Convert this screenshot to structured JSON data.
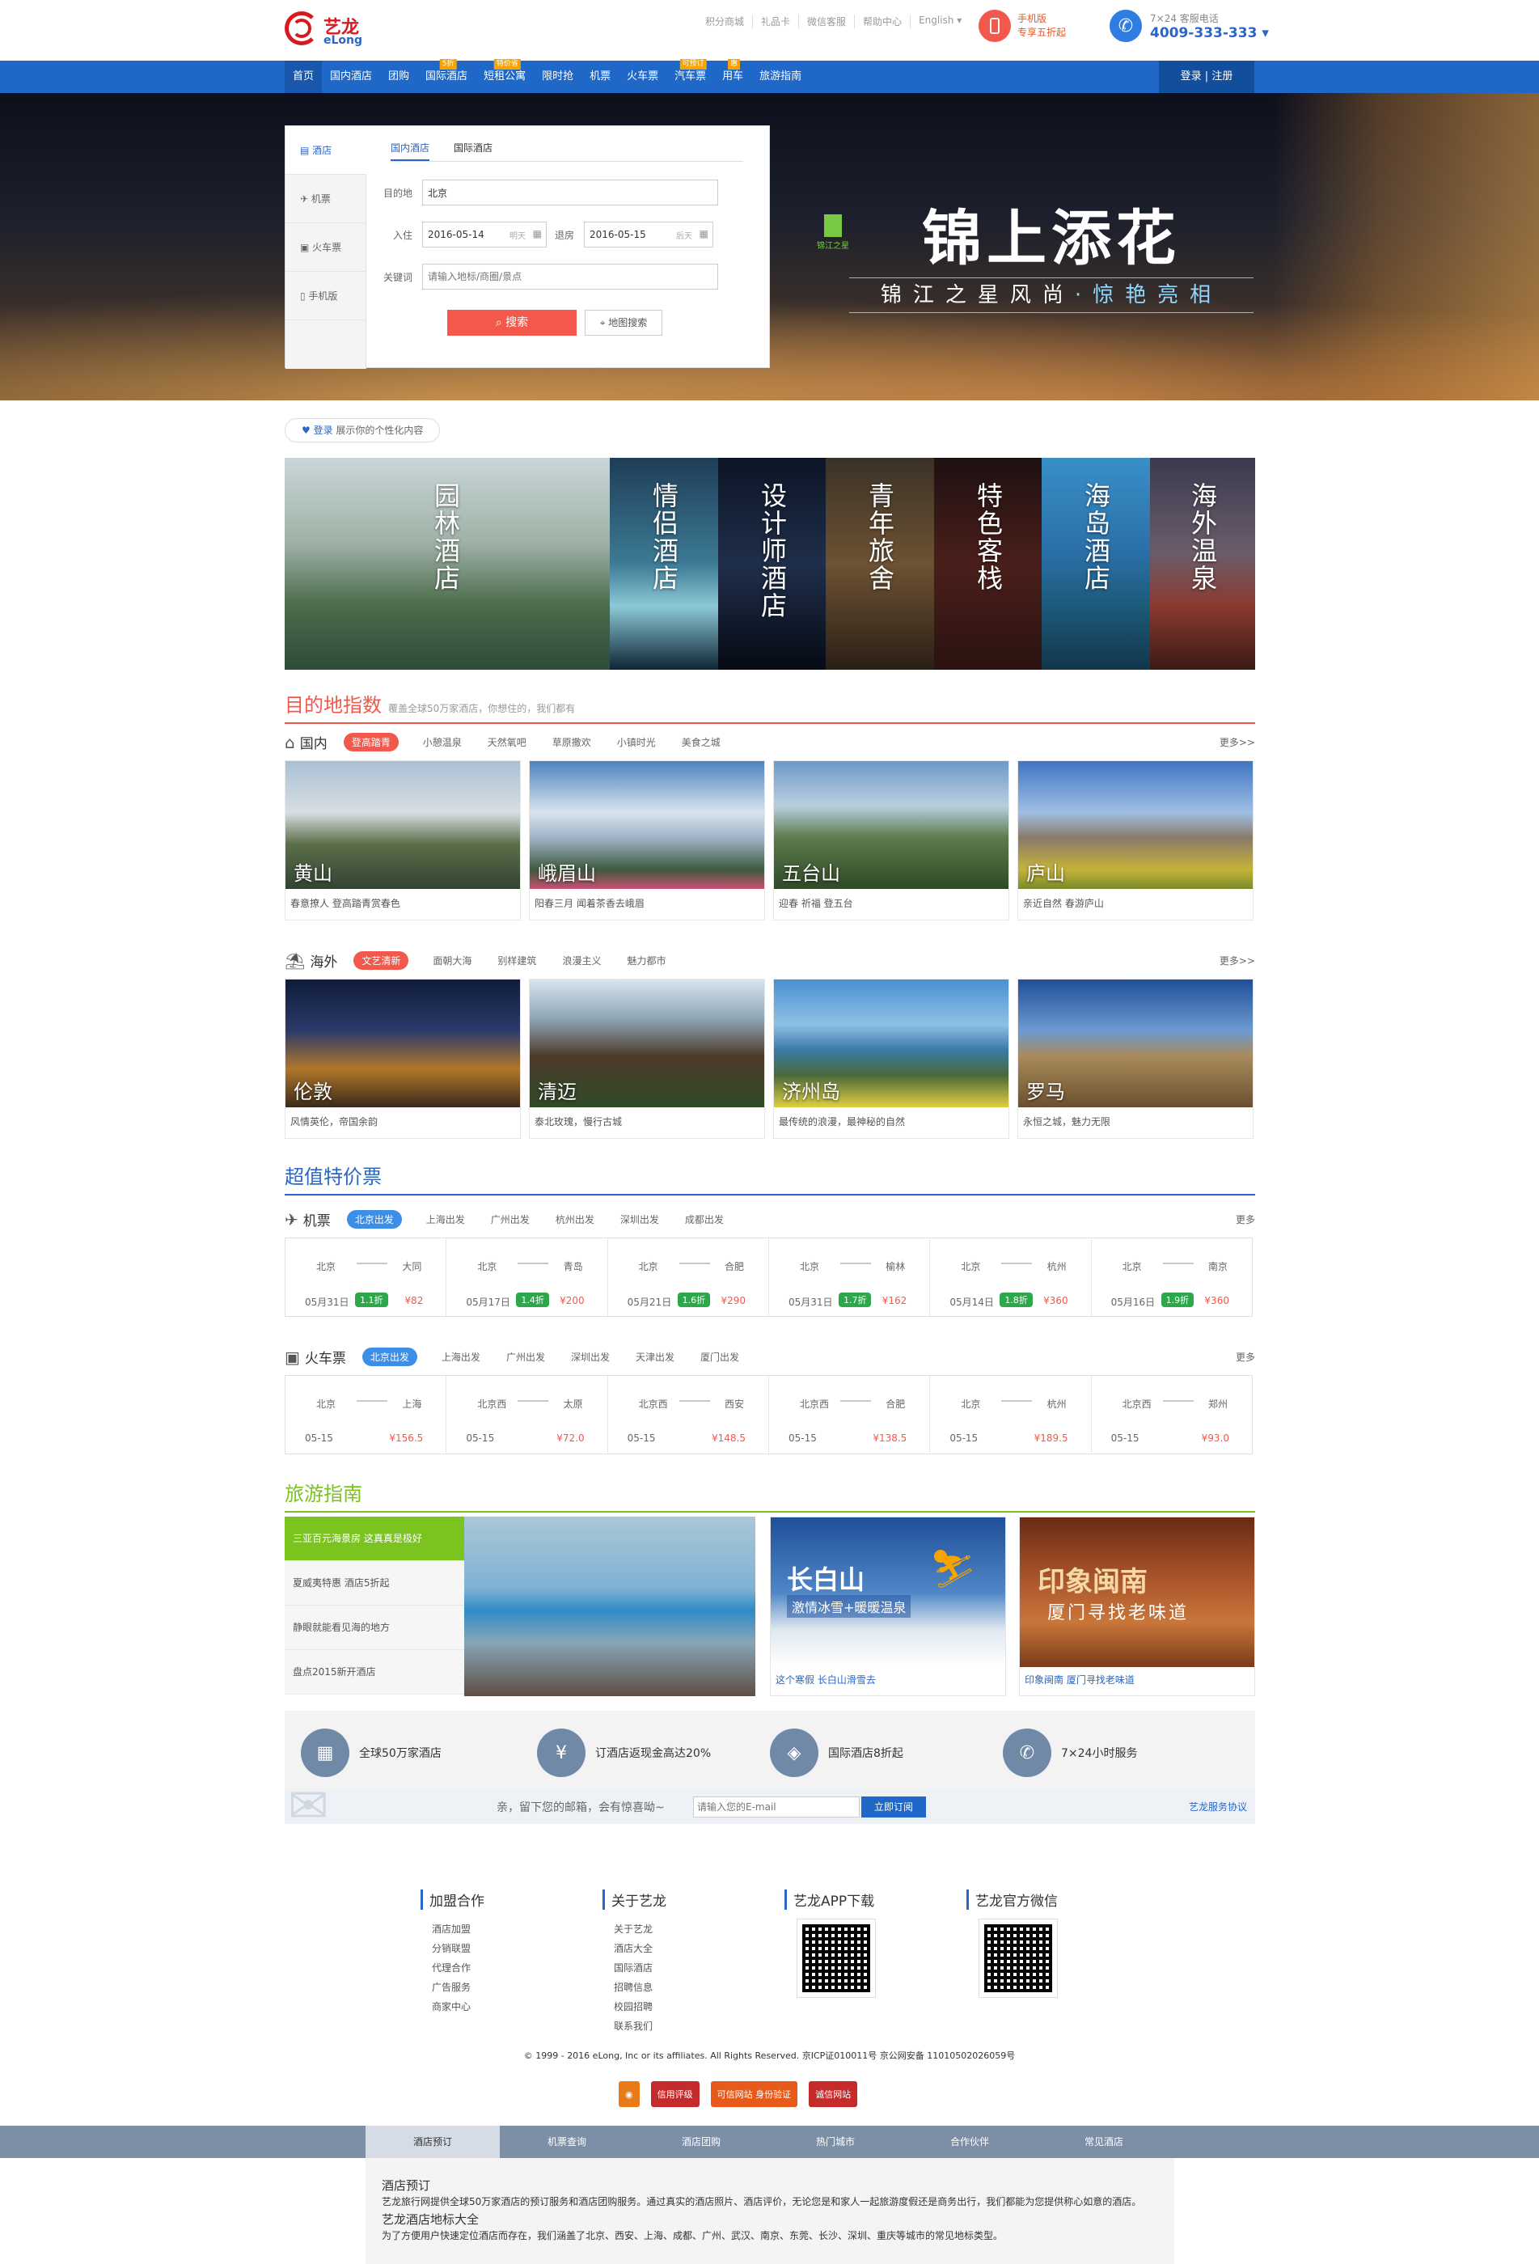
{
  "header": {
    "logo_cn": "艺龙",
    "logo_en": "eLong",
    "links": [
      "积分商城",
      "礼品卡",
      "微信客服",
      "帮助中心",
      "English ▾"
    ],
    "mobile_line1": "手机版",
    "mobile_line2": "专享五折起",
    "phone_label": "7×24 客服电话",
    "phone_number": "4009-333-333 ▾"
  },
  "nav": {
    "items": [
      {
        "label": "首页",
        "tag": ""
      },
      {
        "label": "国内酒店",
        "tag": ""
      },
      {
        "label": "团购",
        "tag": ""
      },
      {
        "label": "国际酒店",
        "tag": "5折"
      },
      {
        "label": "短租公寓",
        "tag": "特价省"
      },
      {
        "label": "限时抢",
        "tag": ""
      },
      {
        "label": "机票",
        "tag": ""
      },
      {
        "label": "火车票",
        "tag": ""
      },
      {
        "label": "汽车票",
        "tag": "可预订"
      },
      {
        "label": "用车",
        "tag": "惠"
      },
      {
        "label": "旅游指南",
        "tag": ""
      }
    ],
    "login": "登录 | 注册"
  },
  "hero": {
    "title": "锦上添花",
    "subtitle_a": "锦江之星风尚",
    "subtitle_dot": "·",
    "subtitle_b": "惊艳亮相",
    "brand": "锦江之星"
  },
  "search": {
    "side": [
      "酒店",
      "机票",
      "火车票",
      "手机版"
    ],
    "tabs": [
      "国内酒店",
      "国际酒店"
    ],
    "dest_label": "目的地",
    "dest_value": "北京",
    "checkin_label": "入住",
    "checkin_value": "2016-05-14",
    "checkin_hint": "明天",
    "checkout_label": "退房",
    "checkout_value": "2016-05-15",
    "checkout_hint": "后天",
    "keyword_label": "关键词",
    "keyword_placeholder": "请输入地标/商圈/景点",
    "search_btn": "搜索",
    "map_btn": "地图搜索"
  },
  "personal": {
    "login": "登录",
    "text": "展示你的个性化内容"
  },
  "themes": [
    "园林酒店",
    "情侣酒店",
    "设计师酒店",
    "青年旅舍",
    "特色客栈",
    "海岛酒店",
    "海外温泉"
  ],
  "destinations": {
    "title": "目的地指数",
    "subtitle": "覆盖全球50万家酒店，你想住的，我们都有",
    "domestic": {
      "name": "国内",
      "chip": "登高踏青",
      "options": [
        "小憩温泉",
        "天然氧吧",
        "草原撒欢",
        "小镇时光",
        "美食之城"
      ],
      "more": "更多>>",
      "cards": [
        {
          "name": "黄山",
          "caption": "春意撩人 登高踏青赏春色"
        },
        {
          "name": "峨眉山",
          "caption": "阳春三月 闻着茶香去峨眉"
        },
        {
          "name": "五台山",
          "caption": "迎春 祈福 登五台"
        },
        {
          "name": "庐山",
          "caption": "亲近自然 春游庐山"
        }
      ]
    },
    "overseas": {
      "name": "海外",
      "chip": "文艺清新",
      "options": [
        "面朝大海",
        "别样建筑",
        "浪漫主义",
        "魅力都市"
      ],
      "more": "更多>>",
      "cards": [
        {
          "name": "伦敦",
          "caption": "风情英伦，帝国余韵"
        },
        {
          "name": "清迈",
          "caption": "泰北玫瑰，慢行古城"
        },
        {
          "name": "济州岛",
          "caption": "最传统的浪漫，最神秘的自然"
        },
        {
          "name": "罗马",
          "caption": "永恒之城，魅力无限"
        }
      ]
    }
  },
  "deals": {
    "title": "超值特价票",
    "flights": {
      "name": "机票",
      "chip": "北京出发",
      "options": [
        "上海出发",
        "广州出发",
        "杭州出发",
        "深圳出发",
        "成都出发"
      ],
      "more": "更多",
      "items": [
        {
          "from": "北京",
          "to": "大同",
          "date": "05月31日",
          "disc": "1.1折",
          "price": "¥82"
        },
        {
          "from": "北京",
          "to": "青岛",
          "date": "05月17日",
          "disc": "1.4折",
          "price": "¥200"
        },
        {
          "from": "北京",
          "to": "合肥",
          "date": "05月21日",
          "disc": "1.6折",
          "price": "¥290"
        },
        {
          "from": "北京",
          "to": "榆林",
          "date": "05月31日",
          "disc": "1.7折",
          "price": "¥162"
        },
        {
          "from": "北京",
          "to": "杭州",
          "date": "05月14日",
          "disc": "1.8折",
          "price": "¥360"
        },
        {
          "from": "北京",
          "to": "南京",
          "date": "05月16日",
          "disc": "1.9折",
          "price": "¥360"
        }
      ]
    },
    "trains": {
      "name": "火车票",
      "chip": "北京出发",
      "options": [
        "上海出发",
        "广州出发",
        "深圳出发",
        "天津出发",
        "厦门出发"
      ],
      "more": "更多",
      "items": [
        {
          "from": "北京",
          "to": "上海",
          "date": "05-15",
          "price": "¥156.5"
        },
        {
          "from": "北京西",
          "to": "太原",
          "date": "05-15",
          "price": "¥72.0"
        },
        {
          "from": "北京西",
          "to": "西安",
          "date": "05-15",
          "price": "¥148.5"
        },
        {
          "from": "北京西",
          "to": "合肥",
          "date": "05-15",
          "price": "¥138.5"
        },
        {
          "from": "北京",
          "to": "杭州",
          "date": "05-15",
          "price": "¥189.5"
        },
        {
          "from": "北京西",
          "to": "郑州",
          "date": "05-15",
          "price": "¥93.0"
        }
      ]
    }
  },
  "guide": {
    "title": "旅游指南",
    "list": [
      "三亚百元海景房 这真真是极好",
      "夏威夷特惠 酒店5折起",
      "静眼就能看见海的地方",
      "盘点2015新开酒店"
    ],
    "card1_title": "长白山",
    "card1_sub": "激情冰雪+暖暖温泉",
    "card1_caption": "这个寒假 长白山滑雪去",
    "card2_title": "印象闽南",
    "card2_sub": "厦门寻找老味道",
    "card2_caption": "印象闽南 厦门寻找老味道"
  },
  "features": [
    {
      "icon": "▦",
      "text": "全球50万家酒店"
    },
    {
      "icon": "¥",
      "text": "订酒店返现金高达20%"
    },
    {
      "icon": "◈",
      "text": "国际酒店8折起"
    },
    {
      "icon": "✆",
      "text": "7×24小时服务"
    }
  ],
  "subscribe": {
    "text": "亲，留下您的邮箱，会有惊喜呦~",
    "placeholder": "请输入您的E-mail",
    "button": "立即订阅",
    "agreement": "艺龙服务协议"
  },
  "footer": {
    "col1": {
      "title": "加盟合作",
      "links": [
        "酒店加盟",
        "分销联盟",
        "代理合作",
        "广告服务",
        "商家中心"
      ]
    },
    "col2": {
      "title": "关于艺龙",
      "links": [
        "关于艺龙",
        "酒店大全",
        "国际酒店",
        "招聘信息",
        "校园招聘",
        "联系我们"
      ]
    },
    "col3": {
      "title": "艺龙APP下载"
    },
    "col4": {
      "title": "艺龙官方微信"
    },
    "copyright": "© 1999 - 2016 eLong, Inc or its affiliates. All Rights Reserved. 京ICP证010011号 京公网安备 11010502026059号",
    "badges": [
      "信用评级",
      "可信网站 身份验证",
      "诚信网站"
    ]
  },
  "bottom_nav": {
    "items": [
      "酒店预订",
      "机票查询",
      "酒店团购",
      "热门城市",
      "合作伙伴",
      "常见酒店"
    ],
    "info_title": "酒店预订",
    "info_text": "艺龙旅行网提供全球50万家酒店的预订服务和酒店团购服务。通过真实的酒店照片、酒店评价，无论您是和家人一起旅游度假还是商务出行，我们都能为您提供称心如意的酒店。",
    "info_title2": "艺龙酒店地标大全",
    "info_text2": "为了方便用户快速定位酒店而存在，我们涵盖了北京、西安、上海、成都、广州、武汉、南京、东莞、长沙、深圳、重庆等城市的常见地标类型。"
  },
  "colors": {
    "brand_blue": "#1f68c7",
    "accent_red": "#f2584b",
    "guide_green": "#7bc41f",
    "discount_green": "#2ca84a"
  }
}
